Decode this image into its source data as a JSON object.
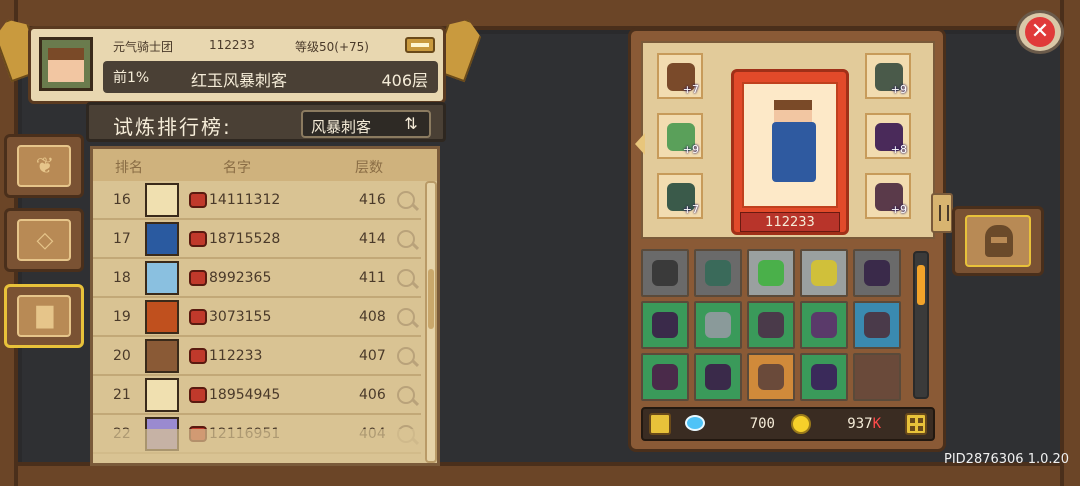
{
  "header": {
    "guild_name": "元气骑士团",
    "player_id": "112233",
    "level": "等级50(+75)",
    "rank_percent": "前1%",
    "hero_name": "红玉风暴刺客",
    "floors": "406层"
  },
  "ranking": {
    "title": "试炼排行榜:",
    "selected_hero": "风暴刺客",
    "columns": {
      "rank": "排名",
      "name": "名字",
      "floors": "层数"
    },
    "rows": [
      {
        "rank": "16",
        "name": "14111312",
        "floors": "416",
        "avatar_color": "#f0e0b0"
      },
      {
        "rank": "17",
        "name": "18715528",
        "floors": "414",
        "avatar_color": "#2a5aa0"
      },
      {
        "rank": "18",
        "name": "8992365",
        "floors": "411",
        "avatar_color": "#8ac0e0"
      },
      {
        "rank": "19",
        "name": "3073155",
        "floors": "408",
        "avatar_color": "#c0501e"
      },
      {
        "rank": "20",
        "name": "112233",
        "floors": "407",
        "avatar_color": "#8a5a36"
      },
      {
        "rank": "21",
        "name": "18954945",
        "floors": "406",
        "avatar_color": "#f0e0b0"
      },
      {
        "rank": "22",
        "name": "12116951",
        "floors": "404",
        "avatar_color": "#9a8ad0"
      }
    ]
  },
  "character": {
    "id_label": "112233",
    "left_slots": [
      {
        "level": "+7",
        "icon": "amulet-icon",
        "color": "#7a4a2a"
      },
      {
        "level": "+9",
        "icon": "ring-icon",
        "color": "#5aa05a"
      },
      {
        "level": "+7",
        "icon": "chest-armor-icon",
        "color": "#3a5a4a"
      }
    ],
    "right_slots": [
      {
        "level": "+9",
        "icon": "gauntlet-icon",
        "color": "#4a5a4a"
      },
      {
        "level": "+8",
        "icon": "shoulder-armor-icon",
        "color": "#4a2a5a"
      },
      {
        "level": "+9",
        "icon": "staff-icon",
        "color": "#5a3a4a"
      }
    ]
  },
  "inventory": {
    "items": [
      {
        "icon": "goggles-icon",
        "bg": "#6a6a6a",
        "color": "#3a3a3a"
      },
      {
        "icon": "helmet-icon",
        "bg": "#6a6a6a",
        "color": "#3a6a5a"
      },
      {
        "icon": "green-potion-icon",
        "bg": "#9aa0a0",
        "color": "#4ab04a"
      },
      {
        "icon": "yellow-potion-icon",
        "bg": "#9aa0a0",
        "color": "#d0c03a"
      },
      {
        "icon": "armor-icon",
        "bg": "#6a6a6a",
        "color": "#3a2a4a"
      },
      {
        "icon": "armor-icon",
        "bg": "#3a9a5a",
        "color": "#3a2a4a"
      },
      {
        "icon": "sword-icon",
        "bg": "#3a9a5a",
        "color": "#8a9a9a"
      },
      {
        "icon": "armor-icon",
        "bg": "#3a9a5a",
        "color": "#4a3a4a"
      },
      {
        "icon": "hood-icon",
        "bg": "#3a9a5a",
        "color": "#5a3a6a"
      },
      {
        "icon": "armor-icon",
        "bg": "#3a8ab0",
        "color": "#4a3a4a"
      },
      {
        "icon": "boots-icon",
        "bg": "#3a9a5a",
        "color": "#4a2a4a"
      },
      {
        "icon": "boots-icon",
        "bg": "#3a9a5a",
        "color": "#3a2a4a"
      },
      {
        "icon": "bow-icon",
        "bg": "#d08a3a",
        "color": "#6a4a3a"
      },
      {
        "icon": "boots-icon",
        "bg": "#3a9a5a",
        "color": "#3a2a5a"
      },
      {
        "icon": "empty-slot",
        "bg": "#6a4a3a",
        "color": "#6a4a3a"
      }
    ],
    "scroll_position": 0.1
  },
  "currency": {
    "gems": "700",
    "coins": "937",
    "coins_suffix": "K"
  },
  "version": "PID2876306 1.0.20"
}
